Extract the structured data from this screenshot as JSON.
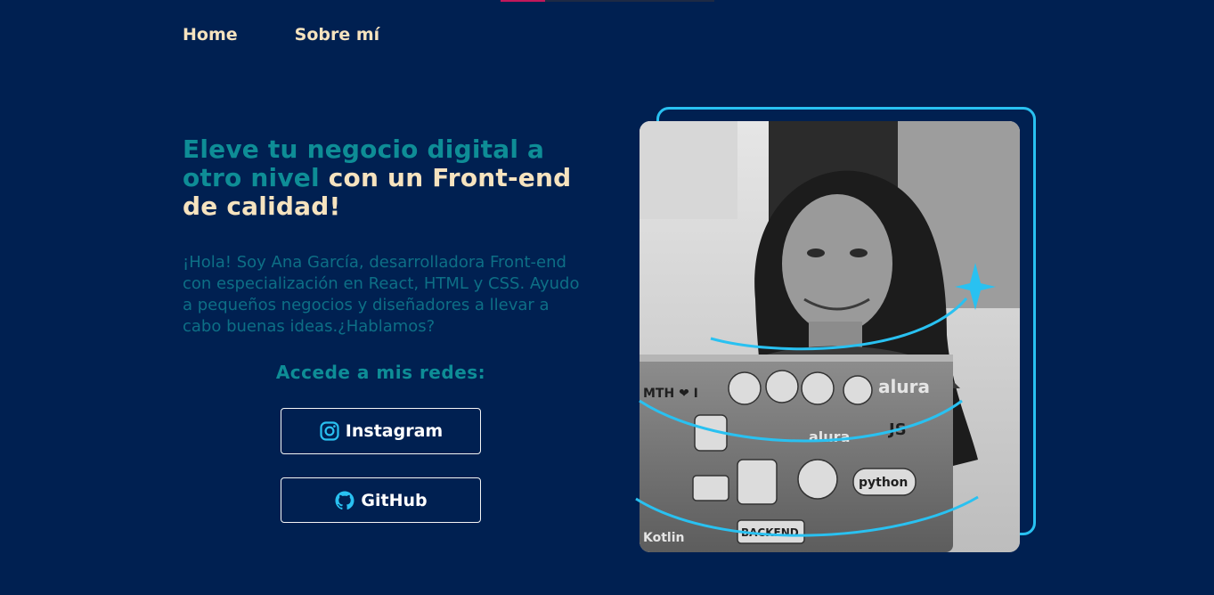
{
  "nav": {
    "items": [
      {
        "label": "Home"
      },
      {
        "label": "Sobre mí"
      }
    ]
  },
  "hero": {
    "headline_part1": "Eleve tu negocio digital a otro nivel",
    "headline_part2": " con un Front-end de calidad!",
    "intro": "¡Hola! Soy Ana García, desarrolladora Front-end con especialización en React, HTML y CSS. Ayudo a pequeños negocios y diseñadores a llevar a cabo buenas ideas.¿Hablamos?"
  },
  "social": {
    "title": "Accede a mis redes:",
    "buttons": [
      {
        "label": "Instagram",
        "icon": "instagram-icon"
      },
      {
        "label": "GitHub",
        "icon": "github-icon"
      }
    ]
  },
  "photo": {
    "laptop_stickers": [
      "MTH ❤ I",
      "alura",
      "JS",
      "alura",
      "python",
      "BACKEND",
      "Kotlin"
    ]
  },
  "colors": {
    "background": "#002051",
    "teal": "#0e8d96",
    "cream": "#f6e3bf",
    "accent_blue": "#29c1f1"
  }
}
